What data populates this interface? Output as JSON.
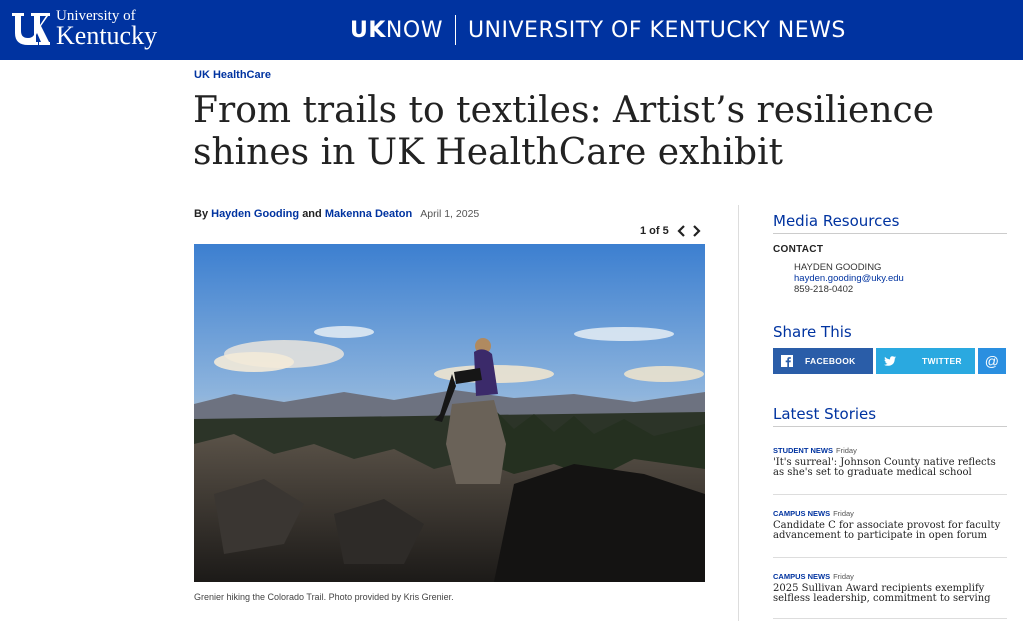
{
  "header": {
    "logo_line1": "University of",
    "logo_line2": "Kentucky",
    "brand_uk": "UK",
    "brand_now": "NOW",
    "brand_sub": "UNIVERSITY OF KENTUCKY NEWS",
    "bg_color": "#0033a0"
  },
  "article": {
    "category": "UK HealthCare",
    "headline": "From trails to textiles: Artist’s resilience shines in UK HealthCare exhibit",
    "byline_prefix": "By",
    "author1": "Hayden Gooding",
    "byline_and": "and",
    "author2": "Makenna Deaton",
    "date": "April 1, 2025",
    "gallery_counter": "1 of 5",
    "photo_caption": "Grenier hiking the Colorado Trail. Photo provided by Kris Grenier."
  },
  "sidebar": {
    "media_heading": "Media Resources",
    "contact_label": "CONTACT",
    "contact_name": "HAYDEN GOODING",
    "contact_email": "hayden.gooding@uky.edu",
    "contact_phone": "859-218-0402",
    "share_heading": "Share This",
    "share_facebook": "FACEBOOK",
    "share_twitter": "TWITTER",
    "share_email": "@",
    "latest_heading": "Latest Stories",
    "stories": [
      {
        "tag": "STUDENT NEWS",
        "day": "Friday",
        "title": "'It's surreal': Johnson County native reflects as she's set to graduate medical school"
      },
      {
        "tag": "CAMPUS NEWS",
        "day": "Friday",
        "title": "Candidate C for associate provost for faculty advancement to participate in open forum"
      },
      {
        "tag": "CAMPUS NEWS",
        "day": "Friday",
        "title": "2025 Sullivan Award recipients exemplify selfless leadership, commitment to serving"
      }
    ]
  }
}
